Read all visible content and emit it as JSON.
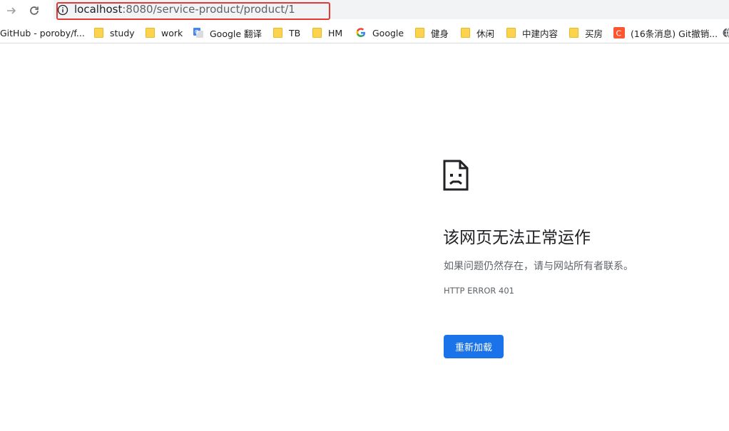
{
  "toolbar": {
    "forward_icon": "arrow-right-icon",
    "reload_icon": "reload-icon",
    "info_icon": "info-icon",
    "url_host": "localhost",
    "url_rest": ":8080/service-product/product/1",
    "highlight_color": "#e53935"
  },
  "bookmarks": [
    {
      "label": "GitHub - poroby/f...",
      "icon": "github-icon"
    },
    {
      "label": "study",
      "icon": "folder-icon"
    },
    {
      "label": "work",
      "icon": "folder-icon"
    },
    {
      "label": "Google 翻译",
      "icon": "google-translate-icon"
    },
    {
      "label": "TB",
      "icon": "folder-icon"
    },
    {
      "label": "HM",
      "icon": "folder-icon"
    },
    {
      "label": "Google",
      "icon": "google-icon"
    },
    {
      "label": "健身",
      "icon": "folder-icon"
    },
    {
      "label": "休闲",
      "icon": "folder-icon"
    },
    {
      "label": "中建内容",
      "icon": "folder-icon"
    },
    {
      "label": "买房",
      "icon": "folder-icon"
    },
    {
      "label": "(16条消息) Git撤销...",
      "icon": "csdn-icon"
    },
    {
      "label": "",
      "icon": "globe-icon"
    }
  ],
  "error": {
    "icon": "broken-page-icon",
    "title": "该网页无法正常运作",
    "message": "如果问题仍然存在，请与网站所有者联系。",
    "code": "HTTP ERROR 401",
    "reload_label": "重新加载",
    "button_color": "#1a73e8"
  }
}
